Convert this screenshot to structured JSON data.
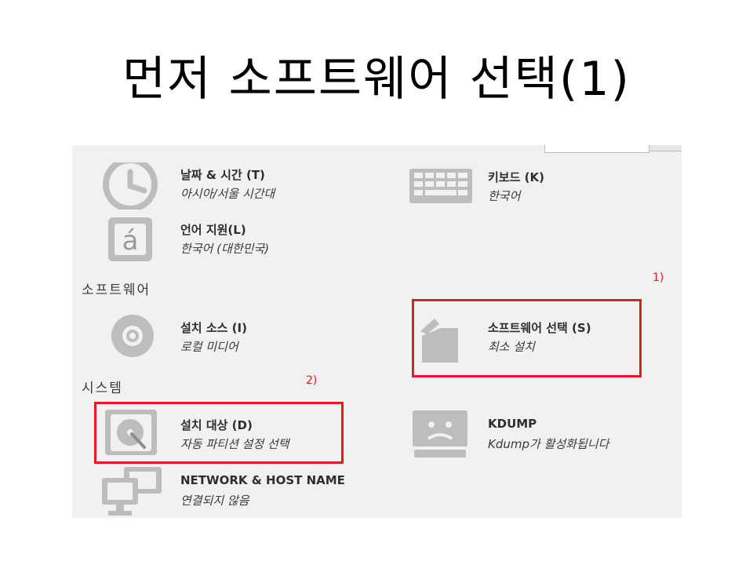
{
  "slide": {
    "title": "먼저 소프트웨어 선택(1)"
  },
  "sections": {
    "software": "소프트웨어",
    "system": "시스템"
  },
  "spokes": {
    "datetime": {
      "title": "날짜 & 시간 (T)",
      "status": "아시아/서울 시간대",
      "icon": "clock-icon"
    },
    "keyboard": {
      "title": "키보드 (K)",
      "status": "한국어",
      "icon": "keyboard-icon"
    },
    "language": {
      "title": "언어 지원(L)",
      "status": "한국어 (대한민국)",
      "icon": "language-icon"
    },
    "source": {
      "title": "설치 소스 (I)",
      "status": "로컬 미디어",
      "icon": "disc-icon"
    },
    "software": {
      "title": "소프트웨어 선택 (S)",
      "status": "최소 설치",
      "icon": "package-icon"
    },
    "destination": {
      "title": "설치 대상 (D)",
      "status": "자동 파티션 설정 선택",
      "icon": "harddisk-icon"
    },
    "kdump": {
      "title": "KDUMP",
      "status": "Kdump가 활성화됩니다",
      "icon": "sad-monitor-icon"
    },
    "network": {
      "title": "NETWORK & HOST NAME",
      "status": "연결되지 않음",
      "icon": "network-icon"
    }
  },
  "annotations": {
    "step1": "1)",
    "step2": "2)"
  },
  "colors": {
    "highlight": "#e01b24",
    "icon_gray": "#bdbdbd",
    "panel_bg": "#f1f1f1"
  }
}
